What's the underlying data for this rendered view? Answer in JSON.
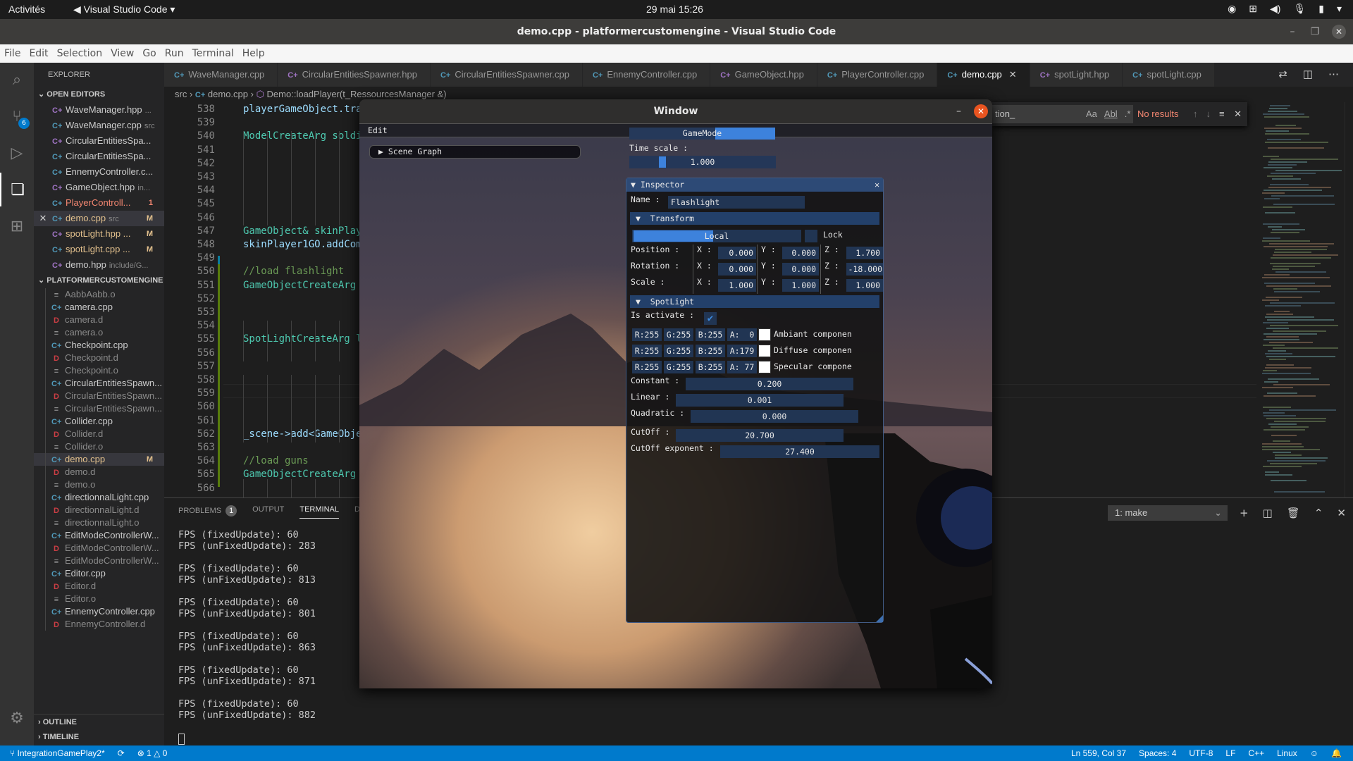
{
  "system_bar": {
    "activities": "Activités",
    "app_name": "Visual Studio Code",
    "clock": "29 mai  15:26",
    "tray_icons": [
      "discord-icon",
      "network-icon",
      "volume-icon",
      "microphone-icon",
      "battery-icon",
      "menu-arrow-icon"
    ]
  },
  "window": {
    "title": "demo.cpp - platformercustomengine - Visual Studio Code"
  },
  "menu": [
    "File",
    "Edit",
    "Selection",
    "View",
    "Go",
    "Run",
    "Terminal",
    "Help"
  ],
  "activity_bar": {
    "scm_badge": "6",
    "items": [
      "search-icon",
      "source-control-icon",
      "run-debug-icon",
      "explorer-icon",
      "extensions-icon"
    ],
    "settings": "gear-icon"
  },
  "explorer": {
    "header": "EXPLORER",
    "open_editors_label": "OPEN EDITORS",
    "open_editors": [
      {
        "name": "WaveManager.hpp",
        "sub": "...",
        "type": "hpp",
        "status": ""
      },
      {
        "name": "WaveManager.cpp",
        "sub": "src",
        "type": "cpp",
        "status": ""
      },
      {
        "name": "CircularEntitiesSpa...",
        "sub": "",
        "type": "hpp",
        "status": ""
      },
      {
        "name": "CircularEntitiesSpa...",
        "sub": "",
        "type": "cpp",
        "status": ""
      },
      {
        "name": "EnnemyController.c...",
        "sub": "",
        "type": "cpp",
        "status": ""
      },
      {
        "name": "GameObject.hpp",
        "sub": "in...",
        "type": "hpp",
        "status": ""
      },
      {
        "name": "PlayerControll...",
        "sub": "",
        "type": "cpp",
        "status": "1",
        "error": true
      },
      {
        "name": "demo.cpp",
        "sub": "src",
        "type": "cpp",
        "status": "M",
        "modified": true,
        "selected": true
      },
      {
        "name": "spotLight.hpp ...",
        "sub": "",
        "type": "hpp",
        "status": "M",
        "modified": true
      },
      {
        "name": "spotLight.cpp ...",
        "sub": "",
        "type": "cpp",
        "status": "M",
        "modified": true
      },
      {
        "name": "demo.hpp",
        "sub": "include/G...",
        "type": "hpp",
        "status": ""
      }
    ],
    "project_label": "PLATFORMERCUSTOMENGINE",
    "files": [
      {
        "name": "AabbAabb.o",
        "type": "o"
      },
      {
        "name": "camera.cpp",
        "type": "cpp"
      },
      {
        "name": "camera.d",
        "type": "d"
      },
      {
        "name": "camera.o",
        "type": "o"
      },
      {
        "name": "Checkpoint.cpp",
        "type": "cpp"
      },
      {
        "name": "Checkpoint.d",
        "type": "d"
      },
      {
        "name": "Checkpoint.o",
        "type": "o"
      },
      {
        "name": "CircularEntitiesSpawn...",
        "type": "cpp"
      },
      {
        "name": "CircularEntitiesSpawn...",
        "type": "d"
      },
      {
        "name": "CircularEntitiesSpawn...",
        "type": "o"
      },
      {
        "name": "Collider.cpp",
        "type": "cpp"
      },
      {
        "name": "Collider.d",
        "type": "d"
      },
      {
        "name": "Collider.o",
        "type": "o"
      },
      {
        "name": "demo.cpp",
        "type": "cpp",
        "status": "M",
        "selected": true
      },
      {
        "name": "demo.d",
        "type": "d"
      },
      {
        "name": "demo.o",
        "type": "o"
      },
      {
        "name": "directionnalLight.cpp",
        "type": "cpp"
      },
      {
        "name": "directionnalLight.d",
        "type": "d"
      },
      {
        "name": "directionnalLight.o",
        "type": "o"
      },
      {
        "name": "EditModeControllerW...",
        "type": "cpp"
      },
      {
        "name": "EditModeControllerW...",
        "type": "d"
      },
      {
        "name": "EditModeControllerW...",
        "type": "o"
      },
      {
        "name": "Editor.cpp",
        "type": "cpp"
      },
      {
        "name": "Editor.d",
        "type": "d"
      },
      {
        "name": "Editor.o",
        "type": "o"
      },
      {
        "name": "EnnemyController.cpp",
        "type": "cpp"
      },
      {
        "name": "EnnemyController.d",
        "type": "d"
      }
    ],
    "outline_label": "OUTLINE",
    "timeline_label": "TIMELINE"
  },
  "tabs": [
    {
      "label": "WaveManager.cpp",
      "type": "cpp"
    },
    {
      "label": "CircularEntitiesSpawner.hpp",
      "type": "hpp"
    },
    {
      "label": "CircularEntitiesSpawner.cpp",
      "type": "cpp"
    },
    {
      "label": "EnnemyController.cpp",
      "type": "cpp"
    },
    {
      "label": "GameObject.hpp",
      "type": "hpp"
    },
    {
      "label": "PlayerController.cpp",
      "type": "cpp"
    },
    {
      "label": "demo.cpp",
      "type": "cpp",
      "active": true
    },
    {
      "label": "spotLight.hpp",
      "type": "hpp"
    },
    {
      "label": "spotLight.cpp",
      "type": "cpp"
    }
  ],
  "breadcrumb": {
    "folder": "src",
    "file": "demo.cpp",
    "symbol": "Demo::loadPlayer(t_RessourcesManager &)"
  },
  "editor": {
    "lines": [
      {
        "n": "538",
        "code": "playerGameObject.tra",
        "cls": "t-var"
      },
      {
        "n": "539",
        "code": "",
        "cls": ""
      },
      {
        "n": "540",
        "code": "ModelCreateArg soldi",
        "cls": "t-type"
      },
      {
        "n": "541",
        "code": "",
        "cls": ""
      },
      {
        "n": "542",
        "code": "",
        "cls": ""
      },
      {
        "n": "543",
        "code": "",
        "cls": ""
      },
      {
        "n": "544",
        "code": "",
        "cls": ""
      },
      {
        "n": "545",
        "code": "",
        "cls": ""
      },
      {
        "n": "546",
        "code": "",
        "cls": ""
      },
      {
        "n": "547",
        "code": "GameObject& skinPlay",
        "cls": "t-type"
      },
      {
        "n": "548",
        "code": "skinPlayer1GO.addCom",
        "cls": "t-var"
      },
      {
        "n": "549",
        "code": "",
        "cls": ""
      },
      {
        "n": "550",
        "code": "//load flashlight",
        "cls": "t-cm"
      },
      {
        "n": "551",
        "code": "GameObjectCreateArg",
        "cls": "t-type"
      },
      {
        "n": "552",
        "code": "",
        "cls": ""
      },
      {
        "n": "553",
        "code": "",
        "cls": ""
      },
      {
        "n": "554",
        "code": "",
        "cls": ""
      },
      {
        "n": "555",
        "code": "SpotLightCreateArg l",
        "cls": "t-type"
      },
      {
        "n": "556",
        "code": "",
        "cls": ""
      },
      {
        "n": "557",
        "code": "",
        "cls": ""
      },
      {
        "n": "558",
        "code": "",
        "cls": ""
      },
      {
        "n": "559",
        "code": "",
        "cls": ""
      },
      {
        "n": "560",
        "code": "",
        "cls": ""
      },
      {
        "n": "561",
        "code": "",
        "cls": ""
      },
      {
        "n": "562",
        "code": "_scene->add<GameObje",
        "cls": "t-var"
      },
      {
        "n": "563",
        "code": "",
        "cls": ""
      },
      {
        "n": "564",
        "code": "//load guns",
        "cls": "t-cm"
      },
      {
        "n": "565",
        "code": "GameObjectCreateArg",
        "cls": "t-type"
      },
      {
        "n": "566",
        "code": "",
        "cls": ""
      }
    ]
  },
  "find_widget": {
    "query": "tion_",
    "options": [
      "Aa",
      "Abl",
      ".*"
    ],
    "result": "No results"
  },
  "panel": {
    "tabs": [
      "PROBLEMS",
      "OUTPUT",
      "TERMINAL",
      "DEBUG CONSOLE"
    ],
    "problems_count": "1",
    "active_tab": "TERMINAL",
    "terminal_select": "1: make",
    "terminal_lines": [
      "FPS (fixedUpdate): 60",
      "FPS (unFixedUpdate): 283",
      "",
      "FPS (fixedUpdate): 60",
      "FPS (unFixedUpdate): 813",
      "",
      "FPS (fixedUpdate): 60",
      "FPS (unFixedUpdate): 801",
      "",
      "FPS (fixedUpdate): 60",
      "FPS (unFixedUpdate): 863",
      "",
      "FPS (fixedUpdate): 60",
      "FPS (unFixedUpdate): 871",
      "",
      "FPS (fixedUpdate): 60",
      "FPS (unFixedUpdate): 882"
    ]
  },
  "status_bar": {
    "branch": "IntegrationGamePlay2*",
    "errors": "1",
    "warnings": "0",
    "position": "Ln 559, Col 37",
    "spaces": "Spaces: 4",
    "encoding": "UTF-8",
    "eol": "LF",
    "language": "C++",
    "platform": "Linux"
  },
  "game_window": {
    "title": "Window",
    "menu_edit": "Edit",
    "scene_graph": "Scene Graph",
    "mode_toggle": {
      "label": "GameMode",
      "fill_fraction": 0.41
    },
    "time_scale": {
      "label": "Time scale :",
      "value": "1.000",
      "slider_fraction": 0.2
    },
    "inspector": {
      "title": "Inspector",
      "name_label": "Name :",
      "name_value": "Flashlight",
      "transform_label": "Transform",
      "space_toggle": {
        "label": "Local",
        "fill_fraction": 0.47
      },
      "lock_label": "Lock",
      "position": {
        "label": "Position :",
        "x": "0.000",
        "y": "0.000",
        "z": "1.700"
      },
      "rotation": {
        "label": "Rotation :",
        "x": "0.000",
        "y": "0.000",
        "z": "-18.000"
      },
      "scale": {
        "label": "Scale :",
        "x": "1.000",
        "y": "1.000",
        "z": "1.000"
      },
      "spotlight_label": "SpotLight",
      "is_activate_label": "Is activate :",
      "is_activate": true,
      "components": [
        {
          "r": "R:255",
          "g": "G:255",
          "b": "B:255",
          "a": "A:  0",
          "label": "Ambiant componen"
        },
        {
          "r": "R:255",
          "g": "G:255",
          "b": "B:255",
          "a": "A:179",
          "label": "Diffuse componen"
        },
        {
          "r": "R:255",
          "g": "G:255",
          "b": "B:255",
          "a": "A: 77",
          "label": "Specular compone"
        }
      ],
      "constant": {
        "label": "Constant :",
        "value": "0.200"
      },
      "linear": {
        "label": "Linear :",
        "value": "0.001"
      },
      "quadratic": {
        "label": "Quadratic :",
        "value": "0.000"
      },
      "cutoff": {
        "label": "CutOff :",
        "value": "20.700"
      },
      "cutoff_exponent": {
        "label": "CutOff exponent :",
        "value": "27.400"
      }
    }
  }
}
